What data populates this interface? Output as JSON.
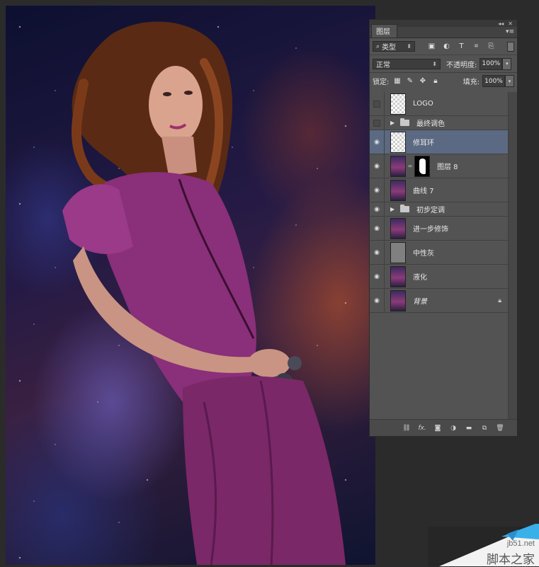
{
  "panel": {
    "tab_label": "图层",
    "filter": {
      "kind_label": "类型"
    },
    "blend": {
      "mode": "正常",
      "opacity_label": "不透明度:",
      "opacity_value": "100%"
    },
    "lock": {
      "label": "锁定:",
      "fill_label": "填充:",
      "fill_value": "100%"
    },
    "layers": [
      {
        "name": "LOGO",
        "type": "pixel",
        "thumb": "transparent",
        "visible": false
      },
      {
        "name": "最终调色",
        "type": "group",
        "visible": false
      },
      {
        "name": "修耳环",
        "type": "pixel",
        "thumb": "transparent",
        "visible": true,
        "selected": true
      },
      {
        "name": "图层 8",
        "type": "pixel-mask",
        "thumb": "photo",
        "visible": true
      },
      {
        "name": "曲线 7",
        "type": "pixel",
        "thumb": "photo",
        "visible": true
      },
      {
        "name": "初步定调",
        "type": "group",
        "visible": true
      },
      {
        "name": "进一步修饰",
        "type": "pixel",
        "thumb": "photo",
        "visible": true
      },
      {
        "name": "中性灰",
        "type": "pixel",
        "thumb": "gray",
        "visible": true
      },
      {
        "name": "液化",
        "type": "pixel",
        "thumb": "photo",
        "visible": true
      },
      {
        "name": "背景",
        "type": "background",
        "thumb": "photo",
        "visible": true,
        "locked": true
      }
    ],
    "footer_icons": [
      "link-layers-icon",
      "fx-icon",
      "add-mask-icon",
      "adjustment-layer-icon",
      "new-group-icon",
      "new-layer-icon",
      "trash-icon"
    ]
  },
  "watermark": {
    "url": "jb51.net",
    "name": "脚本之家"
  }
}
